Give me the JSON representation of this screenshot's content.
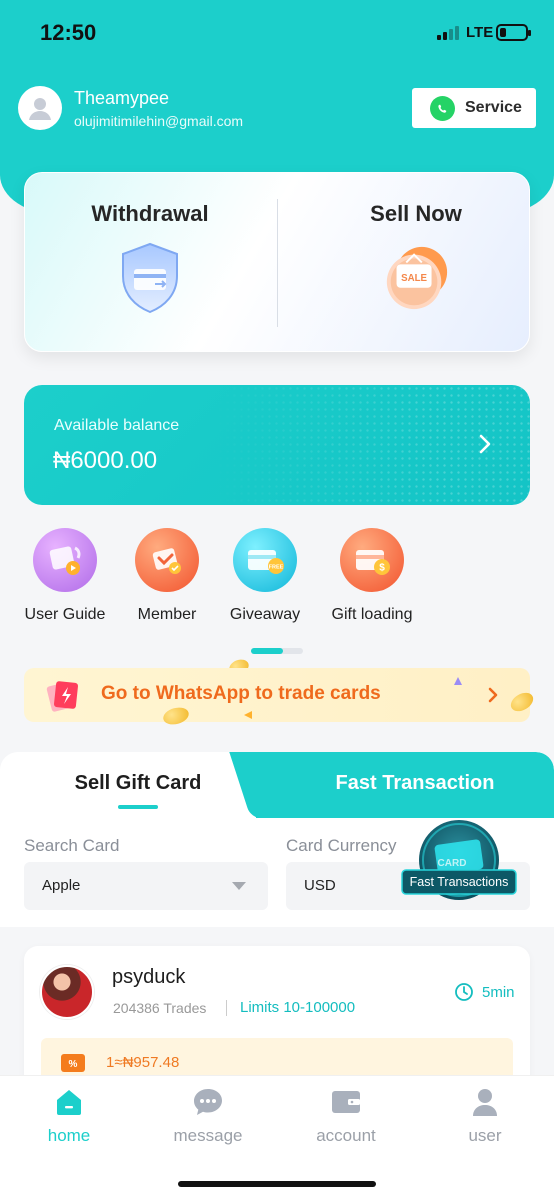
{
  "status_bar": {
    "time": "12:50",
    "network": "LTE"
  },
  "profile": {
    "name": "Theamypee",
    "email": "olujimitimilehin@gmail.com"
  },
  "service_button": {
    "label": "Service",
    "icon": "whatsapp-icon"
  },
  "actions": [
    {
      "label": "Withdrawal",
      "icon": "shield-card-icon"
    },
    {
      "label": "Sell Now",
      "icon": "sale-tag-icon",
      "badge": "SALE"
    }
  ],
  "balance": {
    "label": "Available balance",
    "value": "₦6000.00"
  },
  "quick_links": [
    {
      "label": "User Guide",
      "icon": "video-guide-icon",
      "color": "#c77bf2"
    },
    {
      "label": "Member",
      "icon": "member-badge-icon",
      "color": "#f86b3f"
    },
    {
      "label": "Giveaway",
      "icon": "free-card-icon",
      "color": "#12c3dd",
      "badge": "FREE"
    },
    {
      "label": "Gift loading",
      "icon": "gift-card-dollar-icon",
      "color": "#f86b3f"
    }
  ],
  "carousel": {
    "pages": 2,
    "active": 1
  },
  "whatsapp_banner": {
    "text": "Go to WhatsApp to trade cards"
  },
  "trade_tabs": {
    "sell": "Sell Gift Card",
    "fast": "Fast Transaction",
    "active": "sell"
  },
  "search": {
    "card_label": "Search Card",
    "card_value": "Apple",
    "currency_label": "Card Currency",
    "currency_value": "USD"
  },
  "fast_badge": {
    "label": "Fast Transactions",
    "card_text": "CARD"
  },
  "trader": {
    "name": "psyduck",
    "trades": "204386 Trades",
    "limits": "Limits 10-100000",
    "time": "5min",
    "rate": "1≈₦957.48"
  },
  "nav": [
    {
      "label": "home",
      "icon": "home-icon",
      "active": true
    },
    {
      "label": "message",
      "icon": "message-icon",
      "active": false
    },
    {
      "label": "account",
      "icon": "wallet-icon",
      "active": false
    },
    {
      "label": "user",
      "icon": "user-icon",
      "active": false
    }
  ],
  "colors": {
    "accent": "#1ccfcb",
    "orange": "#ef6a1d",
    "whatsapp": "#25d366"
  }
}
